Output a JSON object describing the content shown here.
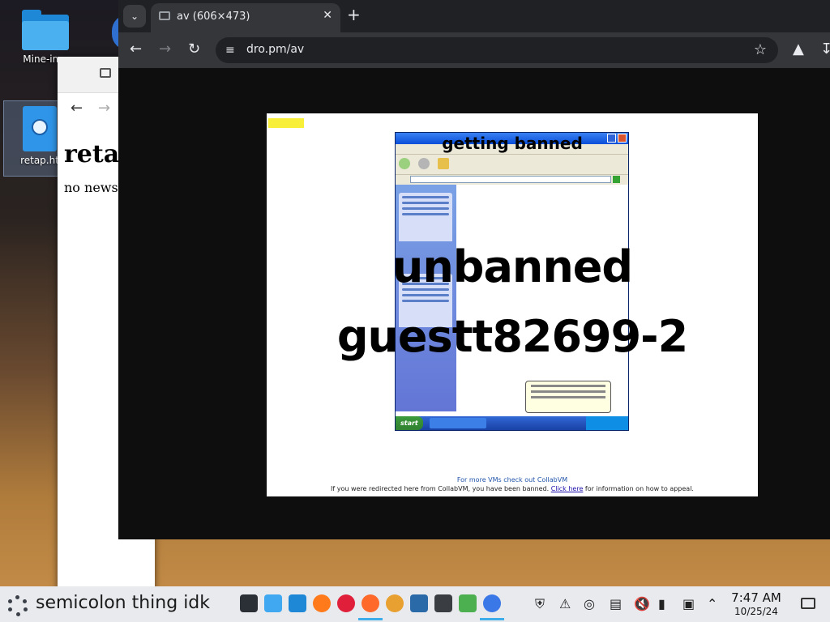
{
  "desktop": {
    "icons": [
      {
        "label": "Mine-ima"
      },
      {
        "label": "retap.ht"
      }
    ]
  },
  "background_window": {
    "heading": "reta",
    "text": "no news"
  },
  "browser": {
    "tab_title": "av (606×473)",
    "url": "dro.pm/av",
    "image": {
      "title_line": "getting banned",
      "line1": "unbanned",
      "line2": "guestt82699-2",
      "footer_middle": "For more VMs check out CollabVM",
      "footer_bottom_prefix": "If you were redirected here from CollabVM, you have been banned.",
      "footer_bottom_link": "Click here",
      "footer_bottom_suffix": "for information on how to appeal."
    }
  },
  "taskbar": {
    "keyboard_layout_label": "semicolon thing idk",
    "time": "7:47 AM",
    "date": "10/25/24",
    "accent": "#3daee9"
  }
}
